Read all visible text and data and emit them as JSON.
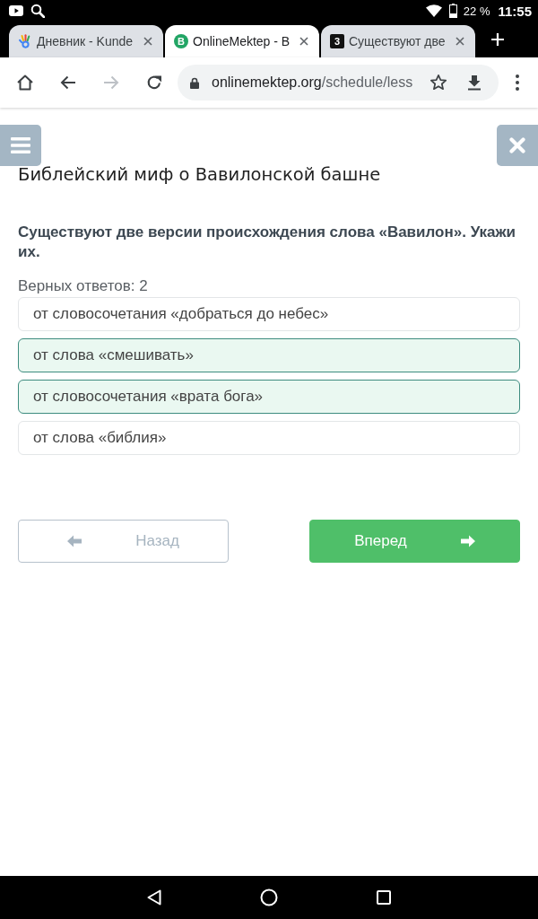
{
  "status_bar": {
    "battery": "22 %",
    "time": "11:55"
  },
  "browser": {
    "tabs": [
      {
        "title": "Дневник - Kunde",
        "selected": false,
        "favicon": {
          "kind": "hand"
        }
      },
      {
        "title": "OnlineMektep - B",
        "selected": true,
        "favicon": {
          "kind": "circle",
          "letter": "B",
          "color": "#22a565"
        }
      },
      {
        "title": "Существуют две",
        "selected": false,
        "favicon": {
          "kind": "tile",
          "letter": "3",
          "color": "#111111"
        }
      }
    ],
    "toolbar": {
      "forward_disabled": true,
      "url": {
        "domain": "onlinemektep.org",
        "path": "/schedule/less"
      }
    }
  },
  "lesson": {
    "title": "Библейский миф о Вавилонской башне",
    "question": "Существуют две версии происхождения слова «Вавилон». Укажи их.",
    "answer_count": "Верных ответов: 2",
    "options": [
      {
        "text": "от словосочетания «добраться до небес»",
        "selected": false
      },
      {
        "text": "от слова «смешивать»",
        "selected": true
      },
      {
        "text": "от словосочетания «врата бога»",
        "selected": true
      },
      {
        "text": "от слова «библия»",
        "selected": false
      }
    ]
  },
  "navigation": {
    "back": {
      "label": "Назад",
      "disabled": true
    },
    "next": {
      "label": "Вперед",
      "disabled": false
    }
  }
}
